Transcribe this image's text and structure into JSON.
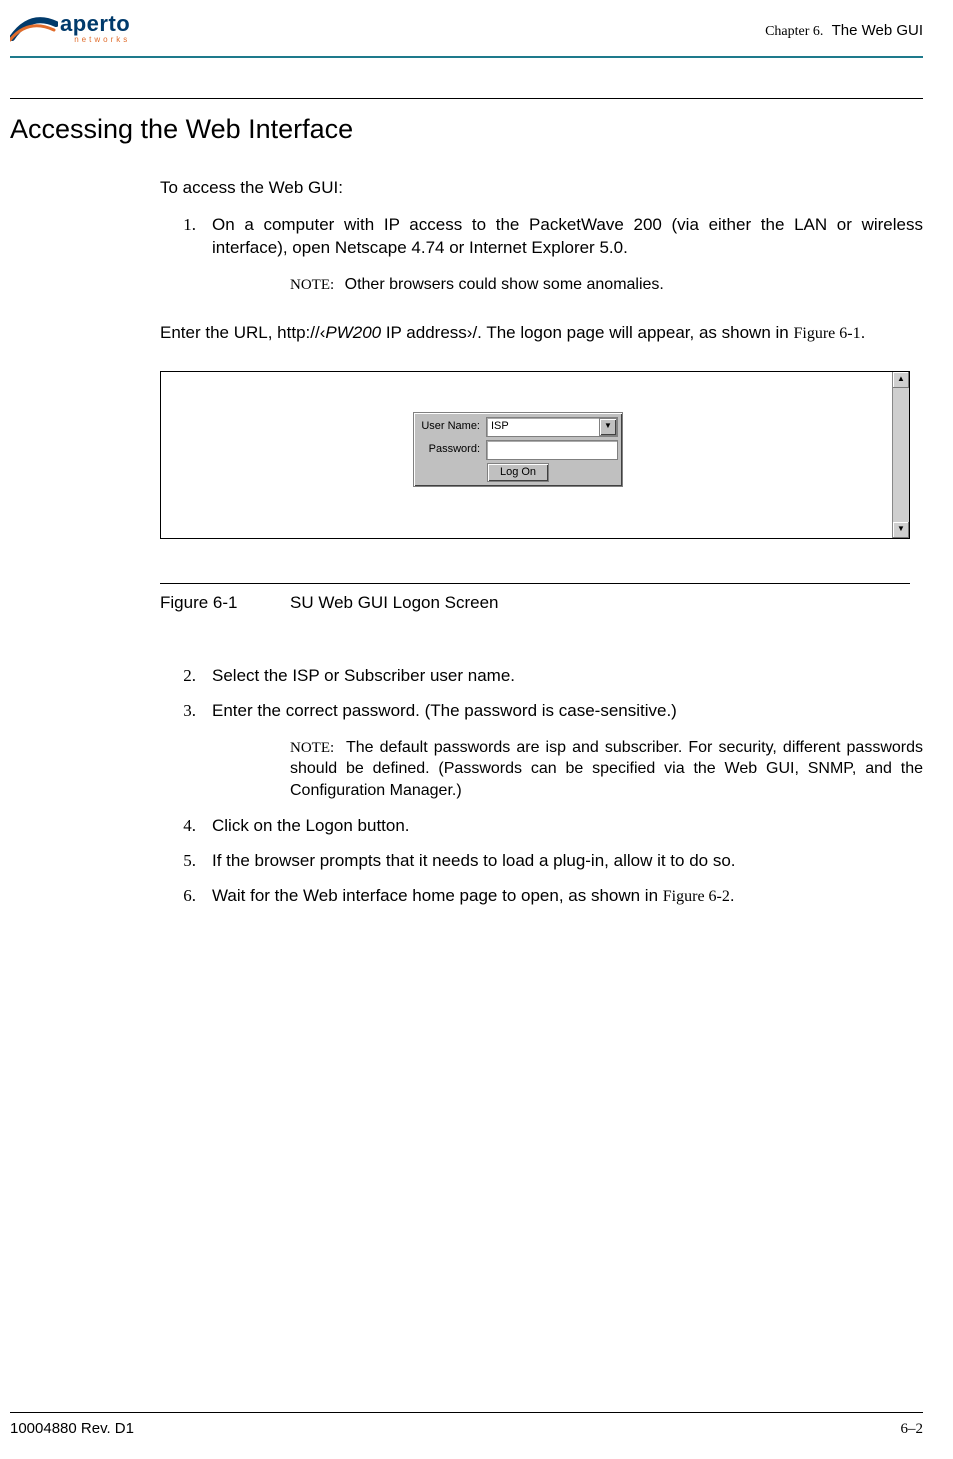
{
  "header": {
    "logo_main": "aperto",
    "logo_sub": "networks",
    "chapter_num": "Chapter 6.",
    "chapter_title": "The Web GUI"
  },
  "section": {
    "title": "Accessing the Web Interface",
    "intro": "To access the Web GUI:",
    "enter_url_prefix": "Enter the URL, http://‹",
    "enter_url_italic": "PW200",
    "enter_url_mid": " IP address›/. The logon page will appear, as shown in ",
    "enter_url_ref": "Figure 6-1",
    "enter_url_end": "."
  },
  "steps_a": [
    {
      "num": "1.",
      "text": "On a computer with IP access to the PacketWave 200 (via either the LAN or wireless interface), open Netscape 4.74 or Internet Explorer 5.0."
    }
  ],
  "note1": {
    "label": "NOTE:",
    "text": "Other browsers could show some anomalies."
  },
  "figure": {
    "number": "Figure 6-1",
    "caption": "SU Web GUI Logon Screen",
    "login": {
      "user_label": "User Name:",
      "user_value": "ISP",
      "pass_label": "Password:",
      "button": "Log On"
    }
  },
  "steps_b": [
    {
      "num": "2.",
      "text": "Select the ISP or Subscriber user name."
    },
    {
      "num": "3.",
      "text": "Enter the correct password. (The password is case-sensitive.)"
    }
  ],
  "note2": {
    "label": "NOTE:",
    "text": "The default passwords are isp and subscriber. For security, different passwords should be defined. (Passwords can be specified via the Web GUI, SNMP, and the Configuration Manager.)"
  },
  "steps_c": [
    {
      "num": "4.",
      "text": "Click on the Logon button."
    },
    {
      "num": "5.",
      "text": "If the browser prompts that it needs to load a plug-in, allow it to do so."
    },
    {
      "num": "6.",
      "text_prefix": "Wait for the Web interface home page to open, as shown in ",
      "ref": "Figure 6-2",
      "text_end": "."
    }
  ],
  "footer": {
    "doc_id": "10004880 Rev. D1",
    "page_num": "6–2"
  }
}
